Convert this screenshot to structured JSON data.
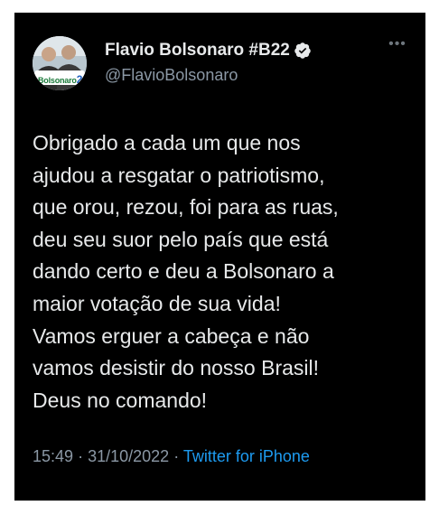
{
  "tweet": {
    "display_name": "Flavio Bolsonaro #B22",
    "handle": "@FlavioBolsonaro",
    "avatar": {
      "brand_text": "Bolsonaro",
      "brand_number": "22"
    },
    "more_icon": "•••",
    "text_lines": [
      "Obrigado a cada um que nos",
      "ajudou a resgatar o patriotismo,",
      "que orou, rezou, foi para as ruas,",
      "deu seu suor pelo país que está",
      "dando certo e deu a Bolsonaro a",
      "maior votação de sua vida!",
      "Vamos erguer a cabeça e não",
      "vamos desistir do nosso Brasil!",
      "Deus no comando!"
    ],
    "time": "15:49",
    "separator": "·",
    "date": "31/10/2022",
    "source": "Twitter for iPhone"
  },
  "colors": {
    "background": "#000000",
    "text": "#e7e9ea",
    "secondary": "#8b98a5",
    "link": "#1d9bf0"
  },
  "icons": [
    "verified-badge-icon",
    "more-options-icon"
  ]
}
